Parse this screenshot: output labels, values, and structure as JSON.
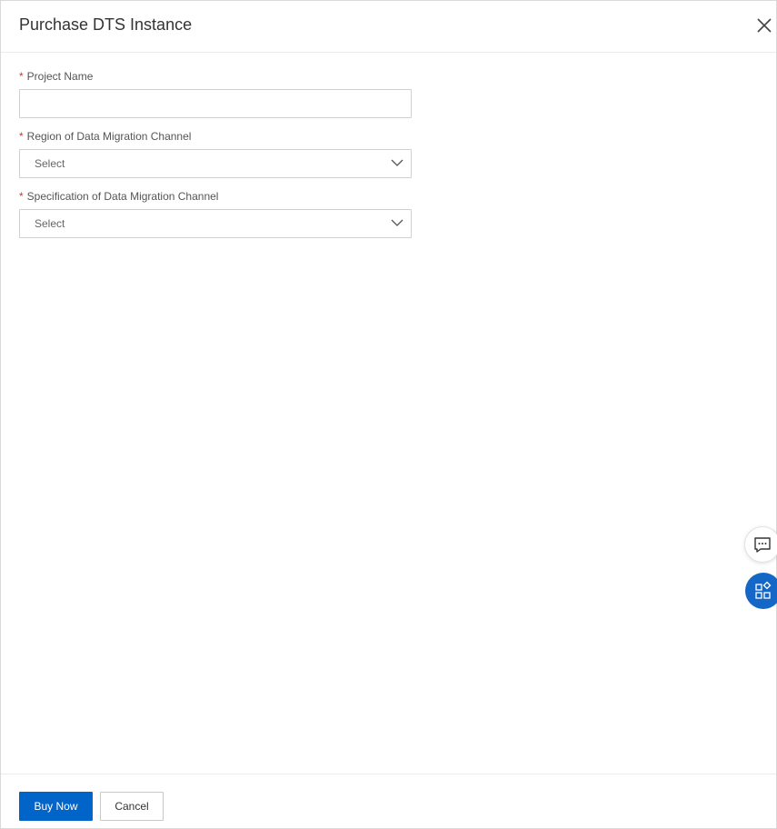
{
  "dialog": {
    "title": "Purchase DTS Instance",
    "close_icon": "close-icon"
  },
  "form": {
    "required_marker": "*",
    "project_name": {
      "label": "Project Name",
      "value": "",
      "placeholder": ""
    },
    "region": {
      "label": "Region of Data Migration Channel",
      "selected": "Select",
      "icon": "chevron-down-icon"
    },
    "specification": {
      "label": "Specification of Data Migration Channel",
      "selected": "Select",
      "icon": "chevron-down-icon"
    }
  },
  "floating": {
    "chat_icon": "chat-icon",
    "apps_icon": "apps-icon",
    "accent": "#1467c7"
  },
  "footer": {
    "buy_now_label": "Buy Now",
    "cancel_label": "Cancel",
    "primary_color": "#0064c8"
  }
}
